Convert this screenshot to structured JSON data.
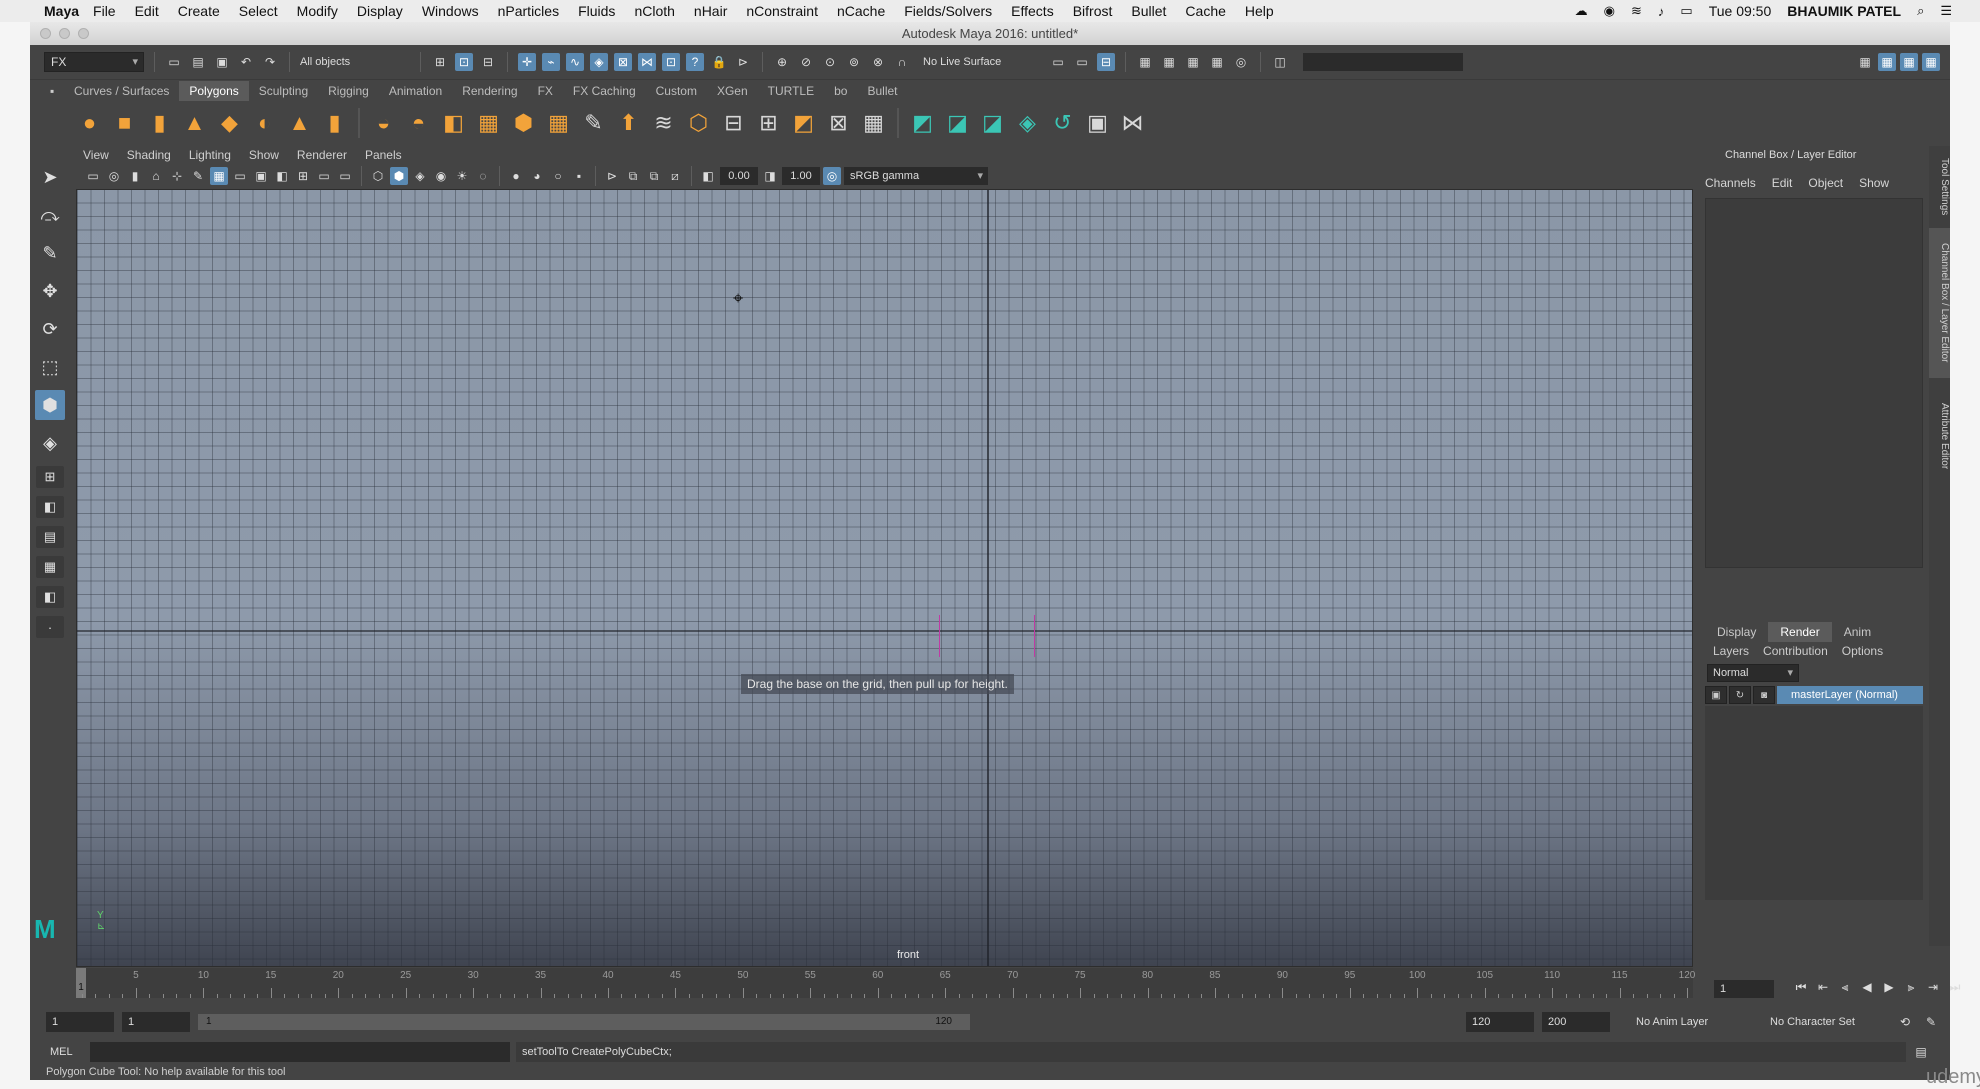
{
  "menubar": {
    "app_name": "Maya",
    "items": [
      "File",
      "Edit",
      "Create",
      "Select",
      "Modify",
      "Display",
      "Windows",
      "nParticles",
      "Fluids",
      "nCloth",
      "nHair",
      "nConstraint",
      "nCache",
      "Fields/Solvers",
      "Effects",
      "Bifrost",
      "Bullet",
      "Cache",
      "Help"
    ],
    "clock": "Tue 09:50",
    "user": "BHAUMIK PATEL"
  },
  "window": {
    "title": "Autodesk Maya 2016: untitled*"
  },
  "statusline": {
    "menuset": "FX",
    "selection_mask": "All objects",
    "live_surface": "No Live Surface"
  },
  "shelf": {
    "tabs": [
      "Curves / Surfaces",
      "Polygons",
      "Sculpting",
      "Rigging",
      "Animation",
      "Rendering",
      "FX",
      "FX Caching",
      "Custom",
      "XGen",
      "TURTLE",
      "bo",
      "Bullet"
    ],
    "active_tab": "Polygons"
  },
  "viewport": {
    "menus": [
      "View",
      "Shading",
      "Lighting",
      "Show",
      "Renderer",
      "Panels"
    ],
    "exposure": "0.00",
    "gamma": "1.00",
    "color_space": "sRGB gamma",
    "hud_message": "Drag the base on the grid, then pull up for height.",
    "camera_name": "front",
    "axis_label": "Y"
  },
  "channelbox": {
    "title": "Channel Box / Layer Editor",
    "menus": [
      "Channels",
      "Edit",
      "Object",
      "Show"
    ]
  },
  "layer_editor": {
    "tabs": [
      "Display",
      "Render",
      "Anim"
    ],
    "active_tab": "Render",
    "submenus": [
      "Layers",
      "Contribution",
      "Options"
    ],
    "blend_mode": "Normal",
    "layer_name": "masterLayer (Normal)"
  },
  "side_tabs": [
    "Tool Settings",
    "Channel Box / Layer Editor",
    "Attribute Editor"
  ],
  "timeslider": {
    "labels": [
      "5",
      "10",
      "15",
      "20",
      "25",
      "30",
      "35",
      "40",
      "45",
      "50",
      "55",
      "60",
      "65",
      "70",
      "75",
      "80",
      "85",
      "90",
      "95",
      "100",
      "105",
      "110",
      "115",
      "120"
    ],
    "current_frame": "1",
    "frame_field": "1"
  },
  "range": {
    "start": "1",
    "playback_start": "1",
    "range_start_label": "1",
    "range_end_label": "120",
    "playback_end": "120",
    "end": "200",
    "anim_layer": "No Anim Layer",
    "character_set": "No Character Set"
  },
  "command": {
    "language": "MEL",
    "result": "setToolTo CreatePolyCubeCtx;"
  },
  "helpline": "Polygon Cube Tool: No help available for this tool",
  "watermark": "udemy"
}
